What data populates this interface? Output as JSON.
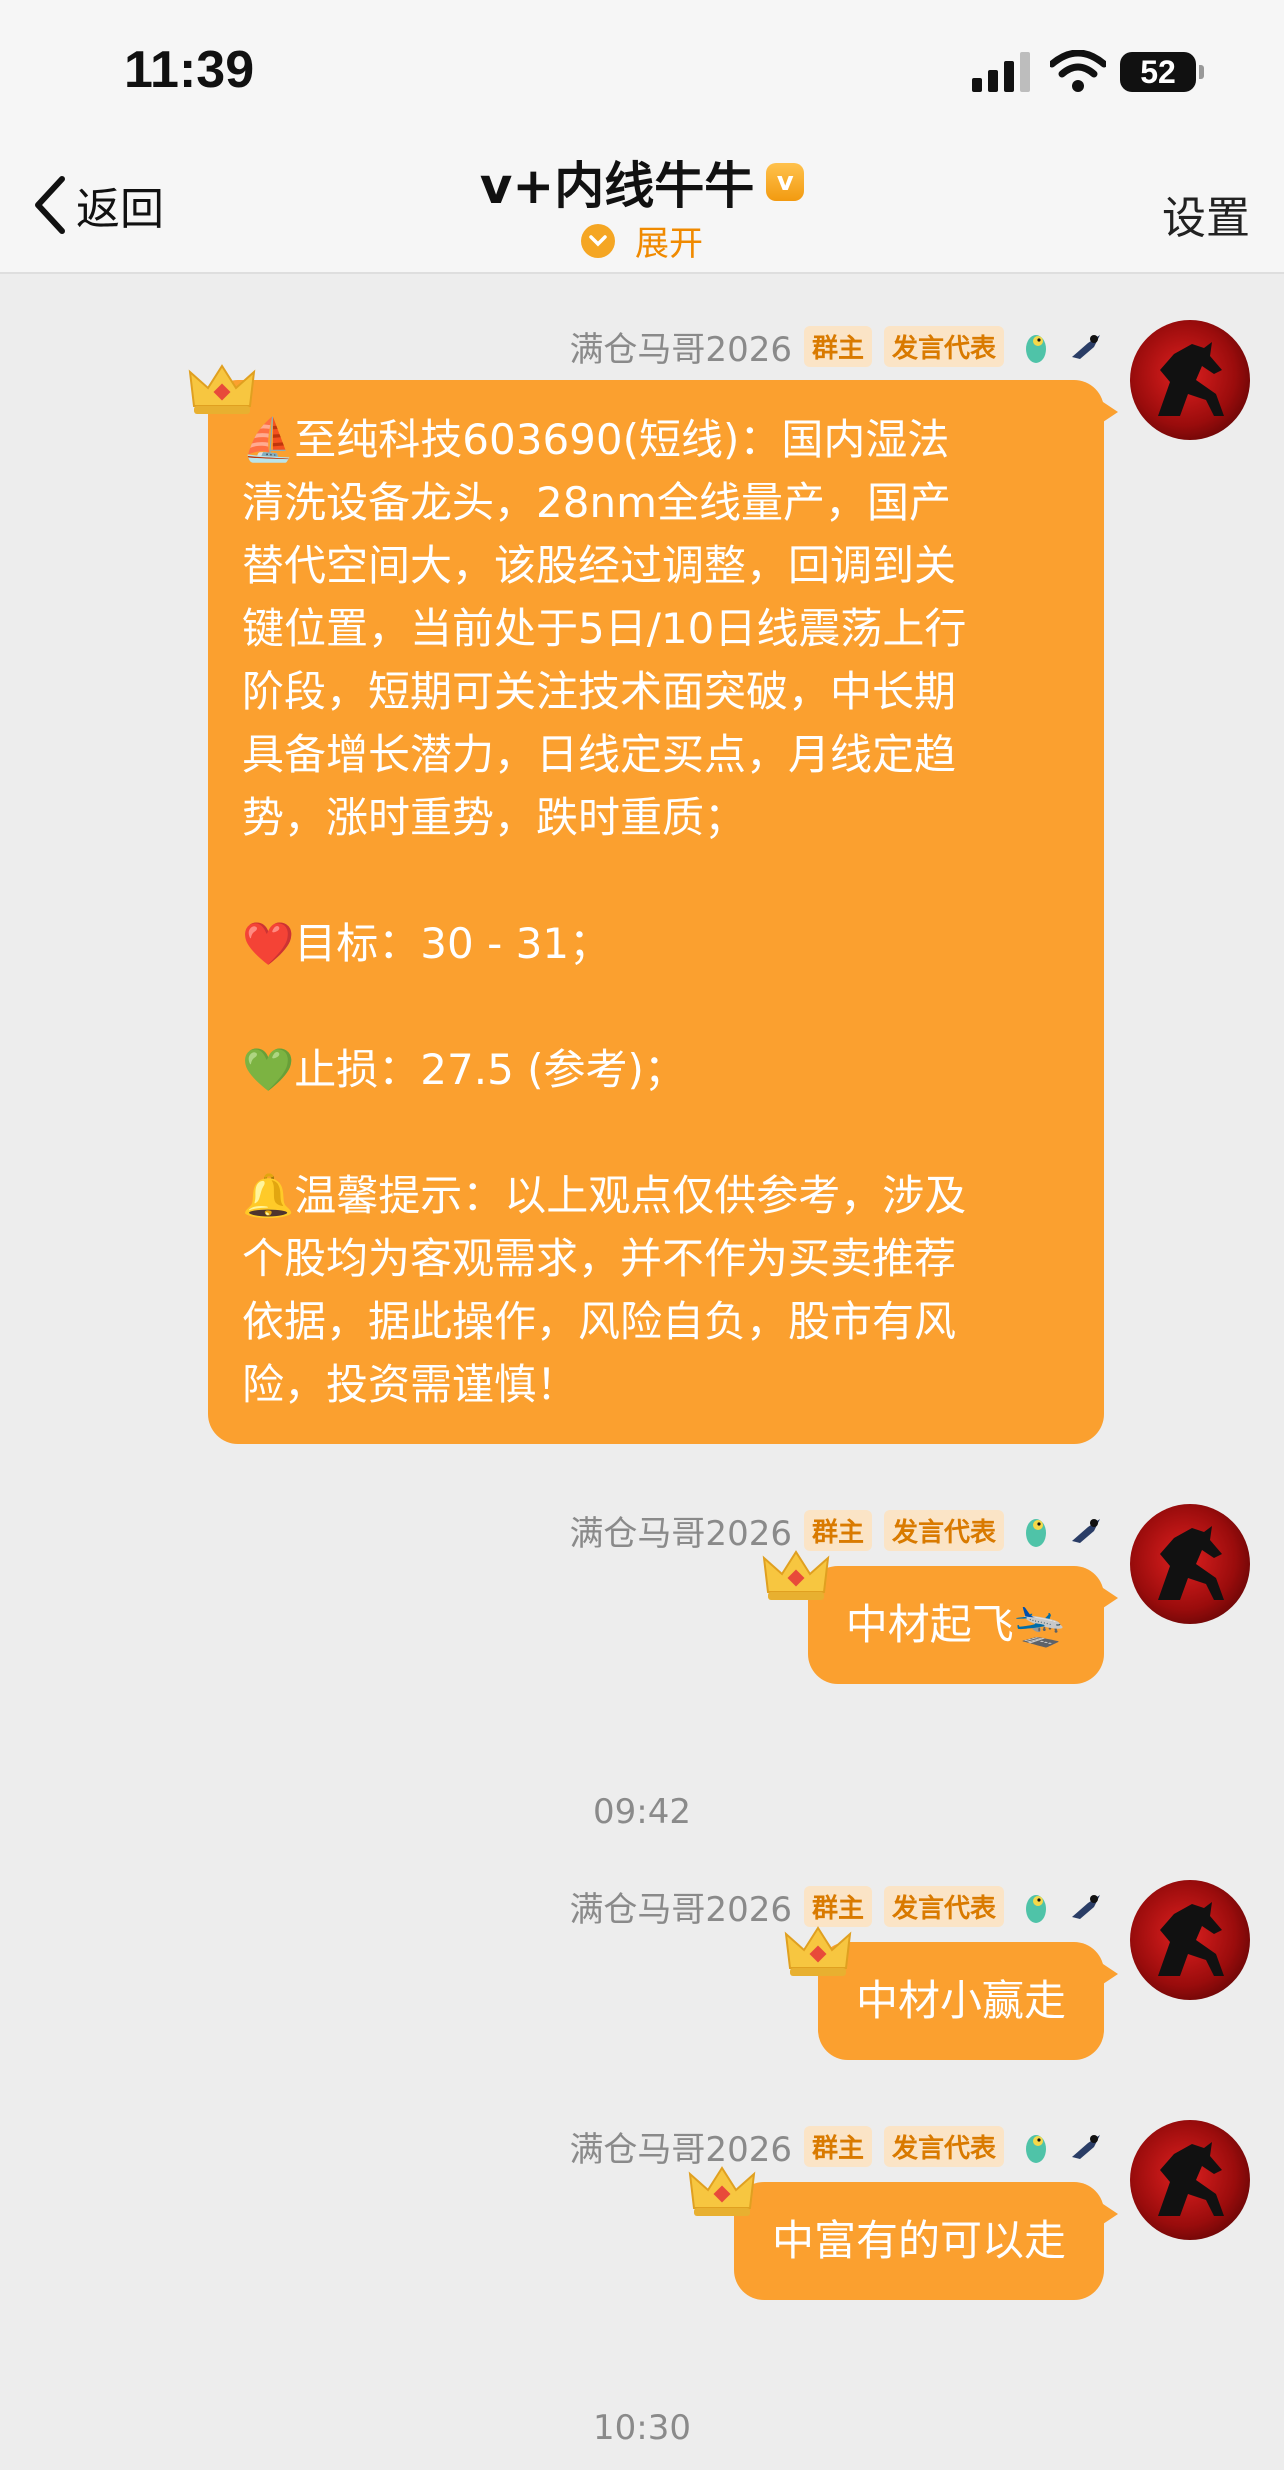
{
  "status": {
    "time": "11:39",
    "battery": "52"
  },
  "nav": {
    "back": "返回",
    "title": "v+内线牛牛",
    "verified_badge": "v",
    "expand": "展开",
    "settings": "设置"
  },
  "sender": {
    "name": "满仓马哥2026",
    "tag_owner": "群主",
    "tag_rep": "发言代表"
  },
  "messages": {
    "m1": {
      "lines": [
        "⛵至纯科技603690(短线)：国内湿法",
        "清洗设备龙头，28nm全线量产，国产",
        "替代空间大，该股经过调整，回调到关",
        "键位置，当前处于5日/10日线震荡上行",
        "阶段，短期可关注技术面突破，中长期",
        "具备增长潜力，日线定买点，月线定趋",
        "势，涨时重势，跌时重质；",
        "",
        "❤️目标：30 - 31；",
        "",
        "💚止损：27.5 (参考)；",
        "",
        "🔔温馨提示：以上观点仅供参考，涉及",
        "个股均为客观需求，并不作为买卖推荐",
        "依据，据此操作，风险自负，股市有风",
        "险，投资需谨慎！"
      ]
    },
    "m2": {
      "text": "中材起飞🛬"
    },
    "time1": "09:42",
    "m3": {
      "text": "中材小赢走"
    },
    "m4": {
      "text": "中富有的可以走"
    },
    "time2": "10:30"
  },
  "icons": {
    "back": "chevron-left-icon",
    "signal": "signal-icon",
    "wifi": "wifi-icon",
    "battery": "battery-icon",
    "crown": "crown-icon",
    "parrot": "parrot-icon",
    "magpie": "magpie-icon",
    "avatar": "horse-avatar"
  },
  "colors": {
    "bubble": "#fba02f",
    "accent": "#f08a00",
    "background": "#ededed"
  }
}
